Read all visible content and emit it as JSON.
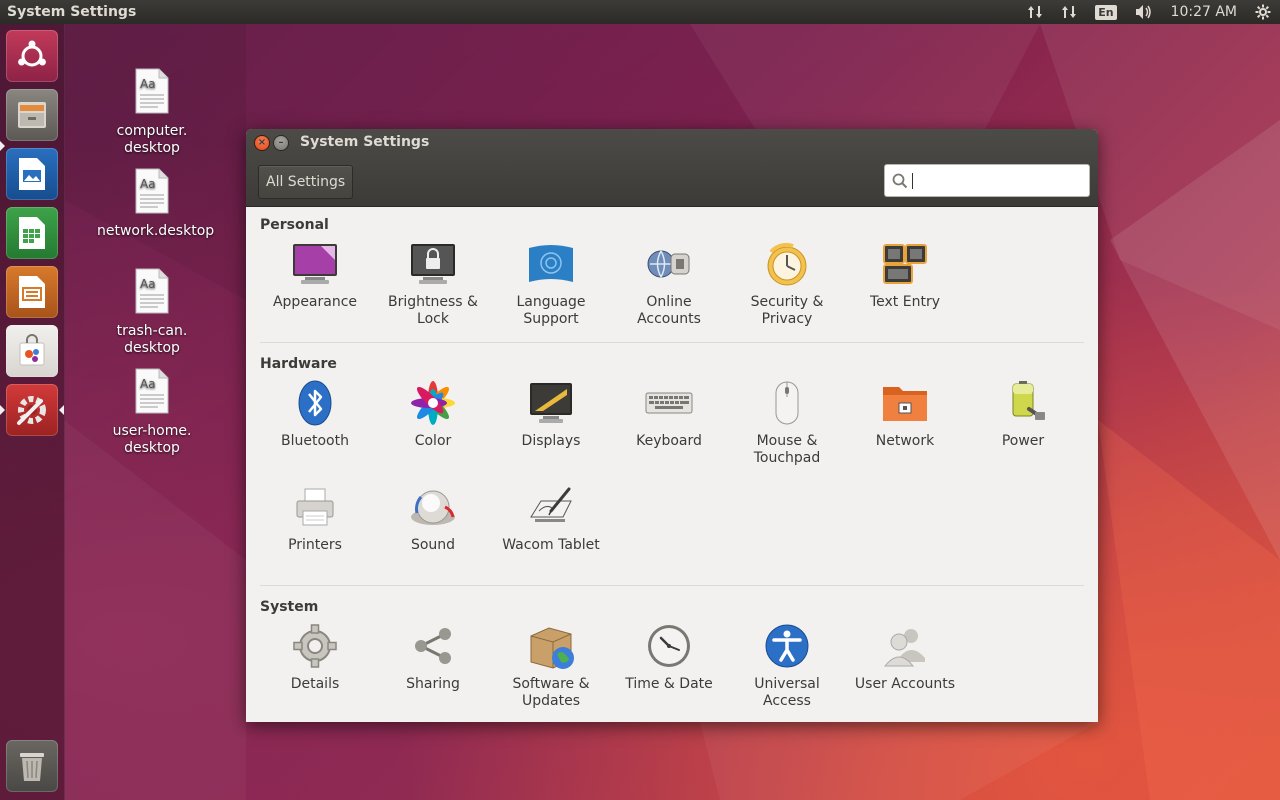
{
  "top_panel": {
    "title": "System Settings",
    "lang": "En",
    "time": "10:27 AM"
  },
  "launcher": {
    "items": [
      {
        "name": "dash-home",
        "icon": "ubuntu-logo-icon"
      },
      {
        "name": "files",
        "icon": "file-cabinet-icon"
      },
      {
        "name": "libreoffice-writer",
        "icon": "writer-document-icon"
      },
      {
        "name": "libreoffice-calc",
        "icon": "calc-spreadsheet-icon"
      },
      {
        "name": "libreoffice-impress",
        "icon": "impress-presentation-icon"
      },
      {
        "name": "software-center",
        "icon": "shopping-bag-icon"
      },
      {
        "name": "system-settings",
        "icon": "settings-wrench-icon"
      },
      {
        "name": "trash",
        "icon": "trash-icon"
      }
    ]
  },
  "desktop": {
    "icons": [
      {
        "label": "computer.\ndesktop"
      },
      {
        "label": "network.desktop"
      },
      {
        "label": "trash-can.\ndesktop"
      },
      {
        "label": "user-home.\ndesktop"
      }
    ]
  },
  "window": {
    "title": "System Settings",
    "all_settings_label": "All Settings",
    "search": {
      "value": "",
      "placeholder": ""
    },
    "sections": {
      "personal": {
        "heading": "Personal",
        "items": [
          "Appearance",
          "Brightness &\nLock",
          "Language\nSupport",
          "Online\nAccounts",
          "Security &\nPrivacy",
          "Text Entry"
        ]
      },
      "hardware": {
        "heading": "Hardware",
        "items": [
          "Bluetooth",
          "Color",
          "Displays",
          "Keyboard",
          "Mouse &\nTouchpad",
          "Network",
          "Power",
          "Printers",
          "Sound",
          "Wacom Tablet"
        ]
      },
      "system": {
        "heading": "System",
        "items": [
          "Details",
          "Sharing",
          "Software &\nUpdates",
          "Time & Date",
          "Universal\nAccess",
          "User Accounts"
        ]
      }
    }
  },
  "colors": {
    "panel": "#3c3b37",
    "window_bg": "#f2f1f0",
    "close_button": "#df4a16",
    "text": "#3c3b37"
  }
}
